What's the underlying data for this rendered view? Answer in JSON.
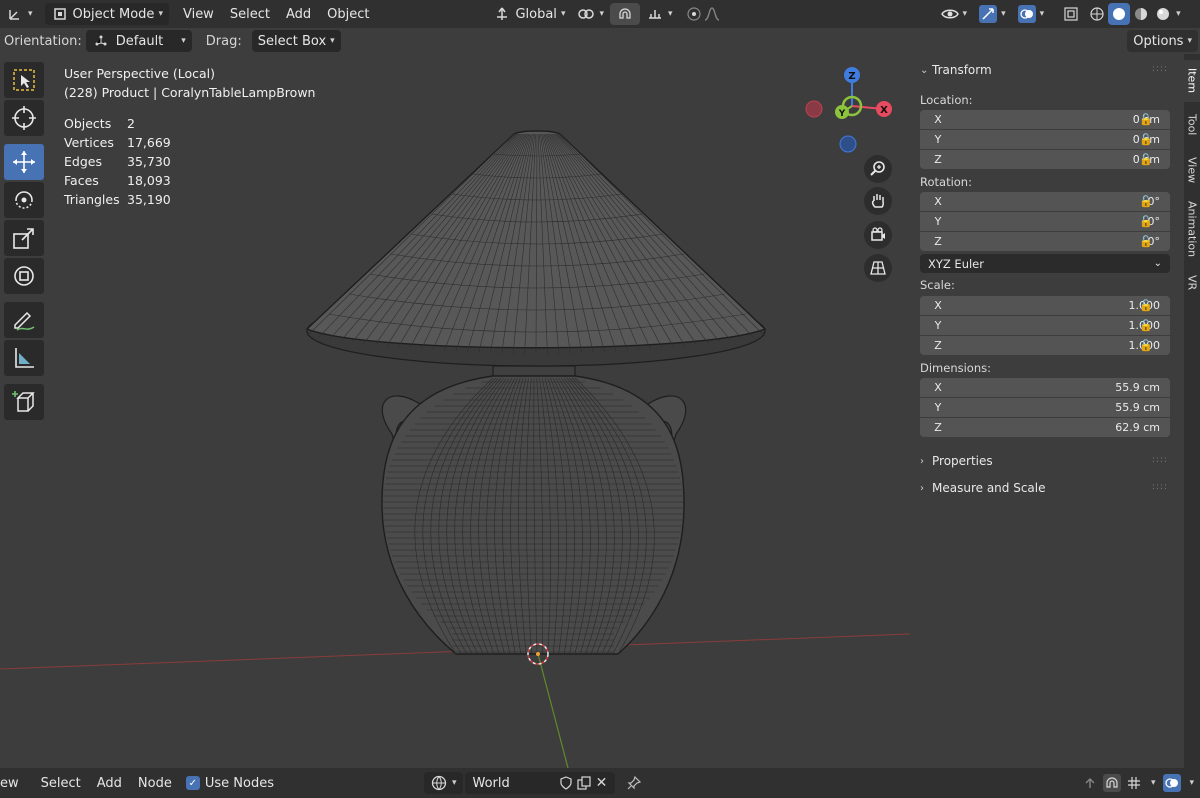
{
  "header": {
    "mode_label": "Object Mode",
    "menus": [
      "View",
      "Select",
      "Add",
      "Object"
    ],
    "orientation_global": "Global"
  },
  "toolsettings": {
    "orientation_label": "Orientation:",
    "orientation_value": "Default",
    "drag_label": "Drag:",
    "drag_value": "Select Box",
    "options_label": "Options"
  },
  "overlay": {
    "perspective": "User Perspective (Local)",
    "object_line": "(228) Product | CoralynTableLampBrown",
    "stats": [
      {
        "label": "Objects",
        "value": "2"
      },
      {
        "label": "Vertices",
        "value": "17,669"
      },
      {
        "label": "Edges",
        "value": "35,730"
      },
      {
        "label": "Faces",
        "value": "18,093"
      },
      {
        "label": "Triangles",
        "value": "35,190"
      }
    ]
  },
  "gizmo": {
    "x": "X",
    "y": "Y",
    "z": "Z"
  },
  "npanel": {
    "transform_label": "Transform",
    "location_label": "Location:",
    "location": [
      {
        "axis": "X",
        "value": "0 cm"
      },
      {
        "axis": "Y",
        "value": "0 cm"
      },
      {
        "axis": "Z",
        "value": "0 cm"
      }
    ],
    "rotation_label": "Rotation:",
    "rotation": [
      {
        "axis": "X",
        "value": "0°"
      },
      {
        "axis": "Y",
        "value": "0°"
      },
      {
        "axis": "Z",
        "value": "0°"
      }
    ],
    "rotation_mode": "XYZ Euler",
    "scale_label": "Scale:",
    "scale": [
      {
        "axis": "X",
        "value": "1.000"
      },
      {
        "axis": "Y",
        "value": "1.000"
      },
      {
        "axis": "Z",
        "value": "1.000"
      }
    ],
    "dimensions_label": "Dimensions:",
    "dimensions": [
      {
        "axis": "X",
        "value": "55.9 cm"
      },
      {
        "axis": "Y",
        "value": "55.9 cm"
      },
      {
        "axis": "Z",
        "value": "62.9 cm"
      }
    ],
    "properties_label": "Properties",
    "measure_label": "Measure and Scale"
  },
  "tabs": [
    "Item",
    "Tool",
    "View",
    "Animation",
    "VR"
  ],
  "bottombar": {
    "menus": [
      "ew",
      "Select",
      "Add",
      "Node"
    ],
    "use_nodes_label": "Use Nodes",
    "world_label": "World"
  },
  "colors": {
    "accent": "#4772b3",
    "x_axis": "#e84a5f",
    "y_axis": "#8cc43c",
    "z_axis": "#3f7de0"
  }
}
